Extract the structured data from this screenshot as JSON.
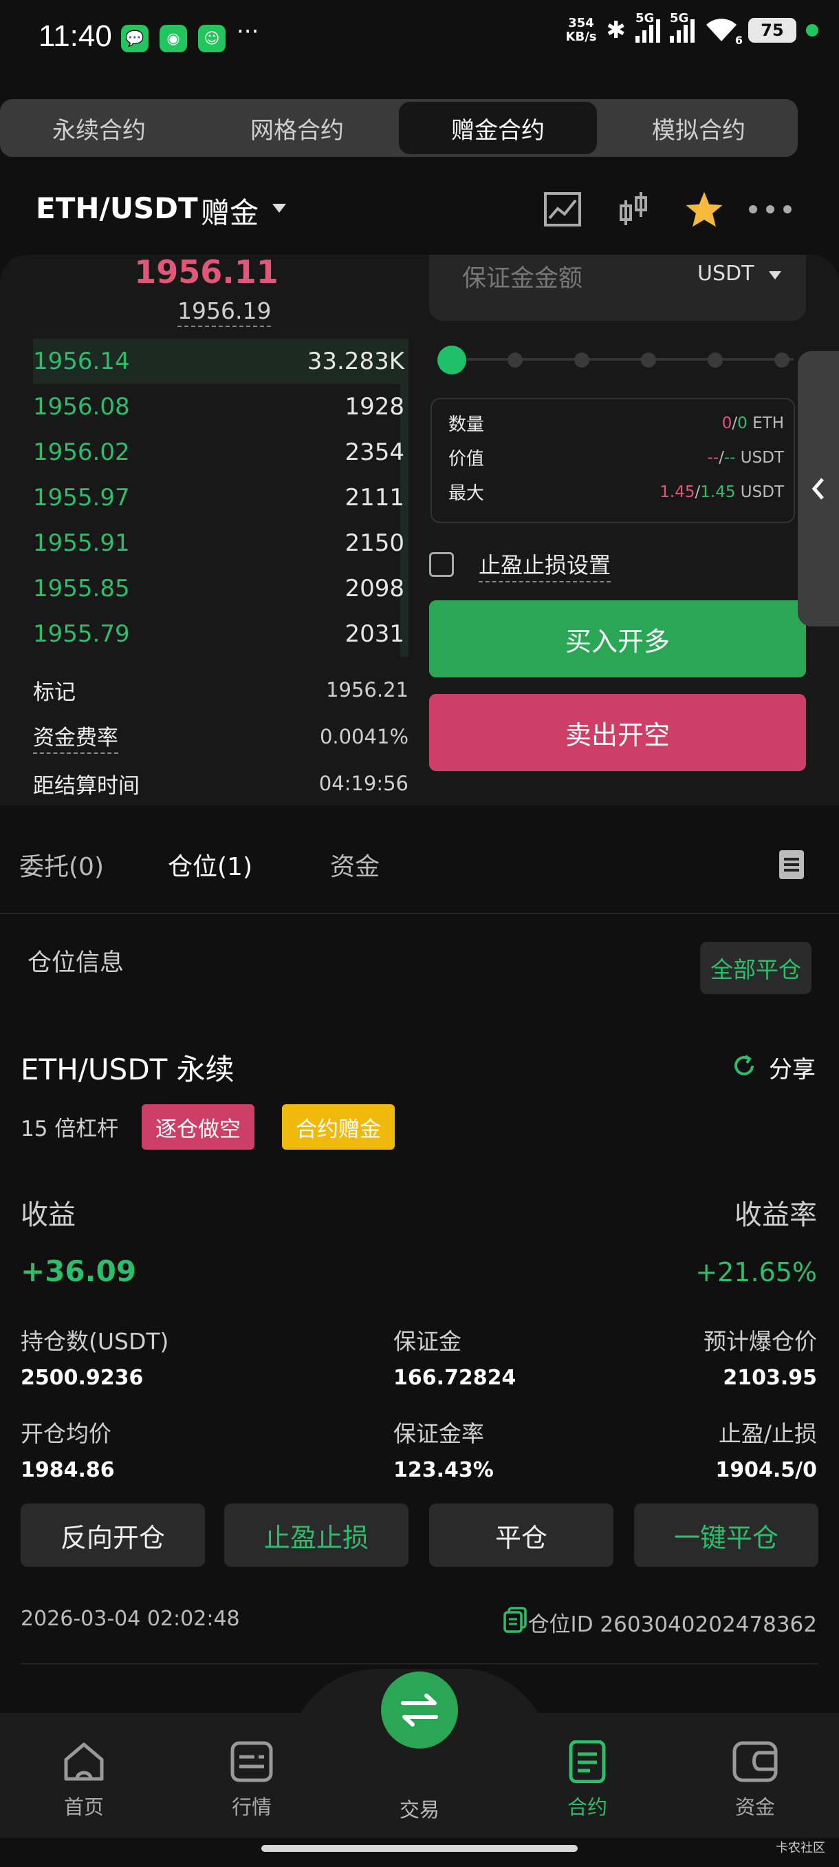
{
  "status_bar": {
    "time": "11:40",
    "net_speed_value": "354",
    "net_speed_unit": "KB/s",
    "network": "5G",
    "network2": "5G",
    "wifi_badge": "6",
    "battery": "75",
    "overflow": "···"
  },
  "tabs": [
    "永续合约",
    "网格合约",
    "赠金合约",
    "模拟合约"
  ],
  "active_tab": 2,
  "header": {
    "pair": "ETH/USDT",
    "mode": "赠金"
  },
  "orderbook": {
    "last_price": "1956.11",
    "mark_price": "1956.19",
    "bids": [
      {
        "price": "1956.14",
        "qty": "33.283K"
      },
      {
        "price": "1956.08",
        "qty": "1928"
      },
      {
        "price": "1956.02",
        "qty": "2354"
      },
      {
        "price": "1955.97",
        "qty": "2111"
      },
      {
        "price": "1955.91",
        "qty": "2150"
      },
      {
        "price": "1955.85",
        "qty": "2098"
      },
      {
        "price": "1955.79",
        "qty": "2031"
      }
    ],
    "mark_label": "标记",
    "mark_value": "1956.21",
    "funding_label": "资金费率",
    "funding_value": "0.0041%",
    "settle_label": "距结算时间",
    "settle_value": "04:19:56"
  },
  "order_form": {
    "amount_placeholder": "保证金金额",
    "amount_unit": "USDT",
    "qty_label": "数量",
    "qty_a": "0",
    "qty_sep": "/",
    "qty_b": "0",
    "qty_unit": "ETH",
    "value_label": "价值",
    "value_a": "--",
    "value_sep": "/",
    "value_b": "--",
    "value_unit": "USDT",
    "max_label": "最大",
    "max_a": "1.45",
    "max_sep": "/",
    "max_b": "1.45",
    "max_unit": "USDT",
    "tpsl_label": "止盈止损设置",
    "buy_label": "买入开多",
    "sell_label": "卖出开空"
  },
  "position_tabs": {
    "orders": "委托(0)",
    "positions": "仓位(1)",
    "funds": "资金"
  },
  "position": {
    "section_title": "仓位信息",
    "close_all": "全部平仓",
    "symbol": "ETH/USDT 永续",
    "share": "分享",
    "leverage": "15 倍杠杆",
    "badge_side": "逐仓做空",
    "badge_bonus": "合约赠金",
    "pnl_label": "收益",
    "pnl_value": "+36.09",
    "roe_label": "收益率",
    "roe_value": "+21.65%",
    "size_label": "持仓数(USDT)",
    "size_value": "2500.9236",
    "margin_label": "保证金",
    "margin_value": "166.72824",
    "liq_label": "预计爆仓价",
    "liq_value": "2103.95",
    "entry_label": "开仓均价",
    "entry_value": "1984.86",
    "margin_ratio_label": "保证金率",
    "margin_ratio_value": "123.43%",
    "tpsl_label": "止盈/止损",
    "tpsl_value": "1904.5/0",
    "actions": [
      "反向开仓",
      "止盈止损",
      "平仓",
      "一键平仓"
    ],
    "timestamp": "2026-03-04 02:02:48",
    "position_id": "仓位ID 2603040202478362"
  },
  "bottom_nav": [
    "首页",
    "行情",
    "交易",
    "合约",
    "资金"
  ],
  "active_nav": 3,
  "watermark": "卡农社区",
  "colors": {
    "green": "#2ebd6b",
    "red": "#cd3f66",
    "pink_text": "#e0577a",
    "yellow": "#f0b90b"
  }
}
